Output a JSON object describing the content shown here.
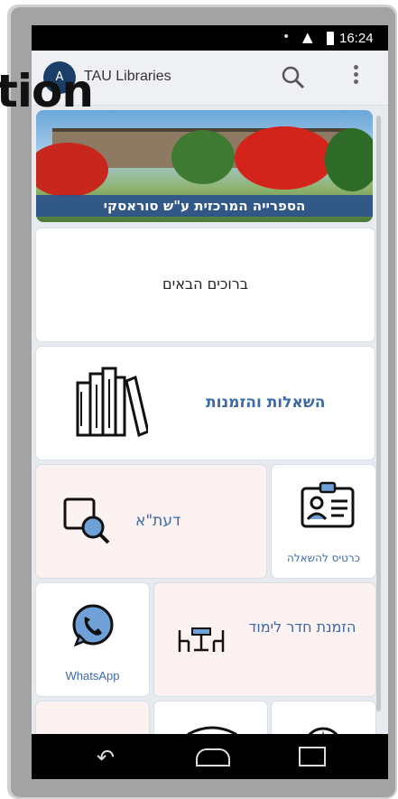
{
  "status_bar": {
    "time": "16:24"
  },
  "app_bar": {
    "logo_text": "A",
    "title": "TAU Libraries"
  },
  "overlay_text": "tion",
  "banner": {
    "caption": "הספרייה המרכזית ע\"ש סוראסקי"
  },
  "tiles": {
    "welcome": "ברוכים הבאים",
    "loans_reservations": "השאלות והזמנות",
    "daata": "דעת\"א",
    "loan_card": "כרטיס להשאלה",
    "whatsapp": "WhatsApp",
    "study_room": "הזמנת חדר לימוד"
  },
  "colors": {
    "accent": "#3c6aa8",
    "banner_label": "#2c538c",
    "pink_tile": "#fdf2f2"
  }
}
